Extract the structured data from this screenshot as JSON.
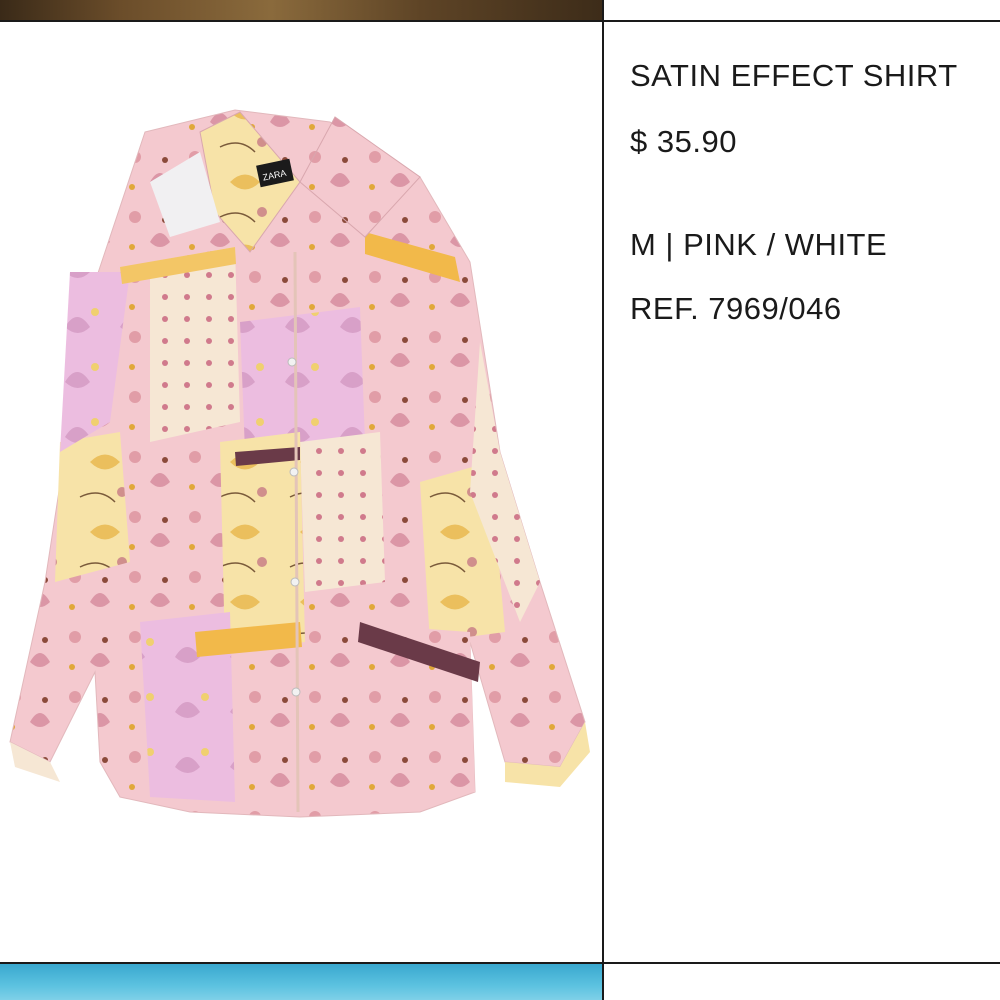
{
  "product": {
    "name": "SATIN EFFECT SHIRT",
    "price": "$ 35.90",
    "variant": "M | PINK / WHITE",
    "reference": "REF. 7969/046",
    "label_logo_text": "ZARA",
    "image_icon": "shirt-product-image"
  },
  "colors": {
    "divider": "#1a1a1a",
    "text": "#1a1a1a",
    "shirt_pink": "#f2a7b0",
    "shirt_yellow": "#f5d27a",
    "shirt_cream": "#f6ead0",
    "shirt_lilac": "#eab6d8",
    "bottom_strip": "#4db8da"
  }
}
